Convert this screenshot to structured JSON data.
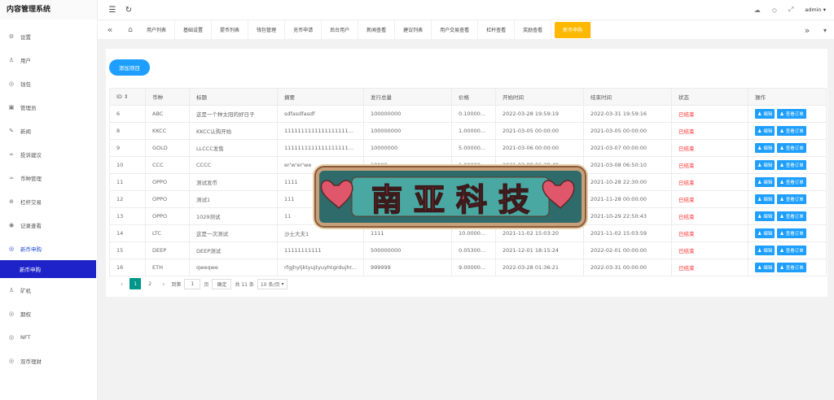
{
  "app": {
    "title": "内容管理系统"
  },
  "topbar": {
    "user": "admin"
  },
  "sidebar": {
    "items": [
      {
        "label": "设置",
        "icon": "gear-icon",
        "glyph": "⚙"
      },
      {
        "label": "用户",
        "icon": "user-icon",
        "glyph": "♙"
      },
      {
        "label": "钱包",
        "icon": "wallet-icon",
        "glyph": "◎"
      },
      {
        "label": "管理员",
        "icon": "admin-icon",
        "glyph": "▣"
      },
      {
        "label": "新闻",
        "icon": "news-icon",
        "glyph": "✎"
      },
      {
        "label": "投诉建议",
        "icon": "link-icon",
        "glyph": "∞"
      },
      {
        "label": "币种管理",
        "icon": "wifi-icon",
        "glyph": "≈"
      },
      {
        "label": "杠杆交易",
        "icon": "lever-icon",
        "glyph": "⊕"
      },
      {
        "label": "记录查看",
        "icon": "record-icon",
        "glyph": "◉"
      },
      {
        "label": "新币申购",
        "icon": "coin-icon",
        "glyph": "◎"
      }
    ],
    "submenu_active": "新币申购",
    "items_after": [
      {
        "label": "矿机",
        "icon": "miner-icon",
        "glyph": "♙"
      },
      {
        "label": "期权",
        "icon": "option-icon",
        "glyph": "◎"
      },
      {
        "label": "NFT",
        "icon": "nft-icon",
        "glyph": "◎"
      },
      {
        "label": "双币理财",
        "icon": "finance-icon",
        "glyph": "◎"
      }
    ]
  },
  "tabs": [
    "用户列表",
    "基础设置",
    "提币列表",
    "钱包管理",
    "充币申请",
    "后台用户",
    "新闻查看",
    "建议列表",
    "用户交易查看",
    "杠杆查看",
    "奖励查看",
    "新币申购"
  ],
  "content": {
    "add_button": "添加项目",
    "columns": [
      "ID",
      "币种",
      "标题",
      "摘要",
      "发行总量",
      "价格",
      "开始时间",
      "结束时间",
      "状态",
      "操作"
    ],
    "rows": [
      [
        "6",
        "ABC",
        "这是一个种太阳的好日子",
        "sdfasdfasdf",
        "100000000",
        "0.10000...",
        "2022-03-28 19:59:19",
        "2022-03-31 19:59:16",
        "已结束"
      ],
      [
        "8",
        "KKCC",
        "KKCC认购开始",
        "1111111111111111111111...",
        "100000000",
        "1.00000...",
        "2021-03-05 00:00:00",
        "2021-03-05 00:00:00",
        "已结束"
      ],
      [
        "9",
        "GOLD",
        "LLCCC发售",
        "1111111111111111111111...",
        "10000000",
        "5.00000...",
        "2021-03-06 00:00:00",
        "2021-03-07 00:00:00",
        "已结束"
      ],
      [
        "10",
        "CCC",
        "CCCC",
        "er'w'er'we",
        "10000",
        "1.00000...",
        "2021-03-08 06:38:49",
        "2021-03-08 06:50:10",
        "已结束"
      ],
      [
        "11",
        "OPPO",
        "测试发币",
        "1111",
        "",
        "",
        "",
        "2021-10-28 22:30:00",
        "已结束"
      ],
      [
        "12",
        "OPPO",
        "测试1",
        "111",
        "",
        "",
        "",
        "2021-11-28 00:00:00",
        "已结束"
      ],
      [
        "13",
        "OPPO",
        "1029测试",
        "11",
        "",
        "",
        "",
        "2021-10-29 22:50:43",
        "已结束"
      ],
      [
        "14",
        "LTC",
        "这是一次测试",
        "沙士大夫1",
        "1111",
        "10.0000...",
        "2021-11-02 15:03:20",
        "2021-11-02 15:03:59",
        "已结束"
      ],
      [
        "15",
        "DEEP",
        "DEEP测试",
        "11111111111",
        "500000000",
        "0.05300...",
        "2021-12-01 18:15:24",
        "2022-02-01 00:00:00",
        "已结束"
      ],
      [
        "16",
        "ETH",
        "qweqwe",
        "rfgjhyljktyujtyuyhtgrdujhr...",
        "999999",
        "9.00000...",
        "2022-03-28 01:36:21",
        "2022-03-31 00:00:00",
        "已结束"
      ]
    ],
    "op_edit": "编辑",
    "op_orders": "查看订单"
  },
  "pager": {
    "pages": [
      "1",
      "2"
    ],
    "goto_label": "到第",
    "goto_value": "1",
    "page_unit": "页",
    "confirm": "确定",
    "total": "共 11 条",
    "page_size": "10 条/页"
  },
  "watermark": {
    "text": "南亚科技"
  },
  "colors": {
    "accent": "#1e9fff",
    "active_tab": "#ffb800",
    "sidebar_active": "#1d22c9",
    "status_ended": "#ff2a2a",
    "pager_current": "#009688"
  }
}
